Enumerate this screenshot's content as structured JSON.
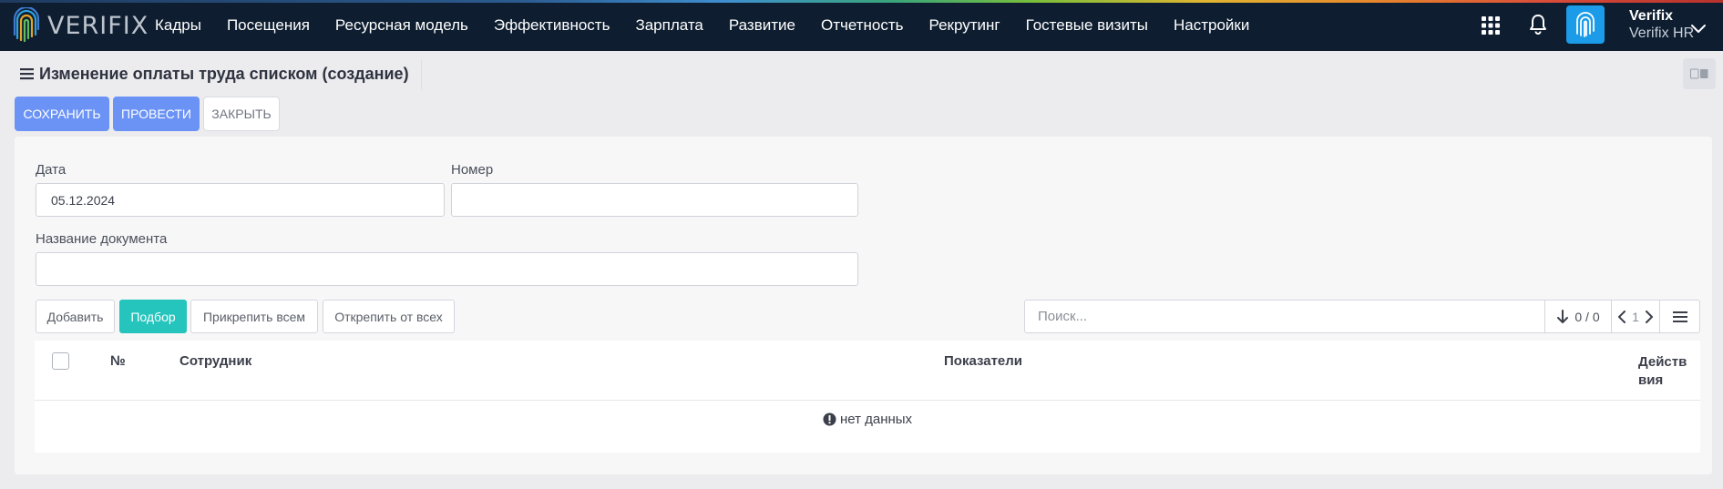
{
  "app": {
    "logo_text": "VERIFIX",
    "nav": [
      "Кадры",
      "Посещения",
      "Ресурсная модель",
      "Эффективность",
      "Зарплата",
      "Развитие",
      "Отчетность",
      "Рекрутинг",
      "Гостевые визиты",
      "Настройки"
    ],
    "user": {
      "name": "Verifix",
      "role": "Verifix HR"
    },
    "icons": [
      "apps-grid-icon",
      "bell-icon",
      "fingerprint-icon",
      "chevron-down-icon"
    ]
  },
  "page": {
    "title": "Изменение оплаты труда списком (создание)"
  },
  "actions": {
    "save": "СОХРАНИТЬ",
    "post": "ПРОВЕСТИ",
    "close": "ЗАКРЫТЬ"
  },
  "form": {
    "date_label": "Дата",
    "date_value": "05.12.2024",
    "number_label": "Номер",
    "number_value": "",
    "doc_name_label": "Название документа",
    "doc_name_value": ""
  },
  "table_toolbar": {
    "add": "Добавить",
    "pick": "Подбор",
    "attach_all": "Прикрепить всем",
    "detach_all": "Открепить от всех",
    "search_placeholder": "Поиск...",
    "count": "0 / 0",
    "page": "1"
  },
  "table": {
    "columns": {
      "num": "№",
      "employee": "Сотрудник",
      "indicators": "Показатели",
      "actions_line1": "Действ",
      "actions_line2": "вия"
    },
    "rows": [],
    "empty_text": "нет данных"
  },
  "colors": {
    "topbar": "#0e1e30",
    "primary": "#6b93f5",
    "teal": "#25c4bc",
    "brand_tile": "#1c9ce8"
  }
}
